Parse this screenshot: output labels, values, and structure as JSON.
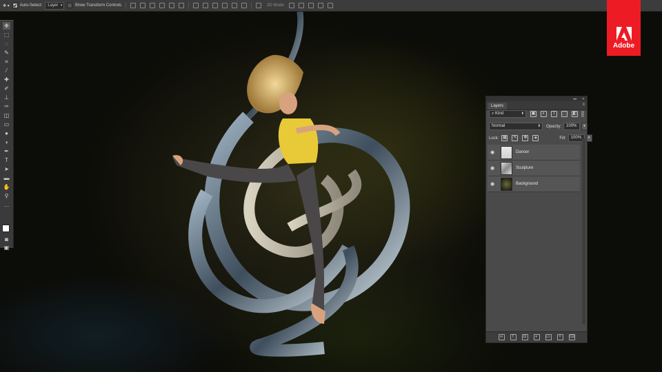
{
  "options_bar": {
    "auto_select_label": "Auto-Select:",
    "auto_select_value": "Layer",
    "transform_label": "Show Transform Controls",
    "mode_label": "3D Mode:"
  },
  "brand": {
    "name": "Adobe",
    "color": "#ed1c24"
  },
  "layers_panel": {
    "tab_label": "Layers",
    "filter_kind": "Kind",
    "blend_mode": "Normal",
    "opacity_label": "Opacity:",
    "opacity_value": "100%",
    "lock_label": "Lock:",
    "fill_label": "Fill:",
    "fill_value": "100%",
    "layers": [
      {
        "name": "Dancer"
      },
      {
        "name": "Sculpture"
      },
      {
        "name": "Background"
      }
    ]
  },
  "tools": [
    "move-icon",
    "marquee-icon",
    "lasso-icon",
    "quick-select-icon",
    "crop-icon",
    "eyedropper-icon",
    "healing-icon",
    "brush-icon",
    "stamp-icon",
    "history-brush-icon",
    "eraser-icon",
    "gradient-icon",
    "blur-icon",
    "dodge-icon",
    "pen-icon",
    "type-icon",
    "path-select-icon",
    "shape-icon",
    "hand-icon",
    "zoom-icon"
  ]
}
